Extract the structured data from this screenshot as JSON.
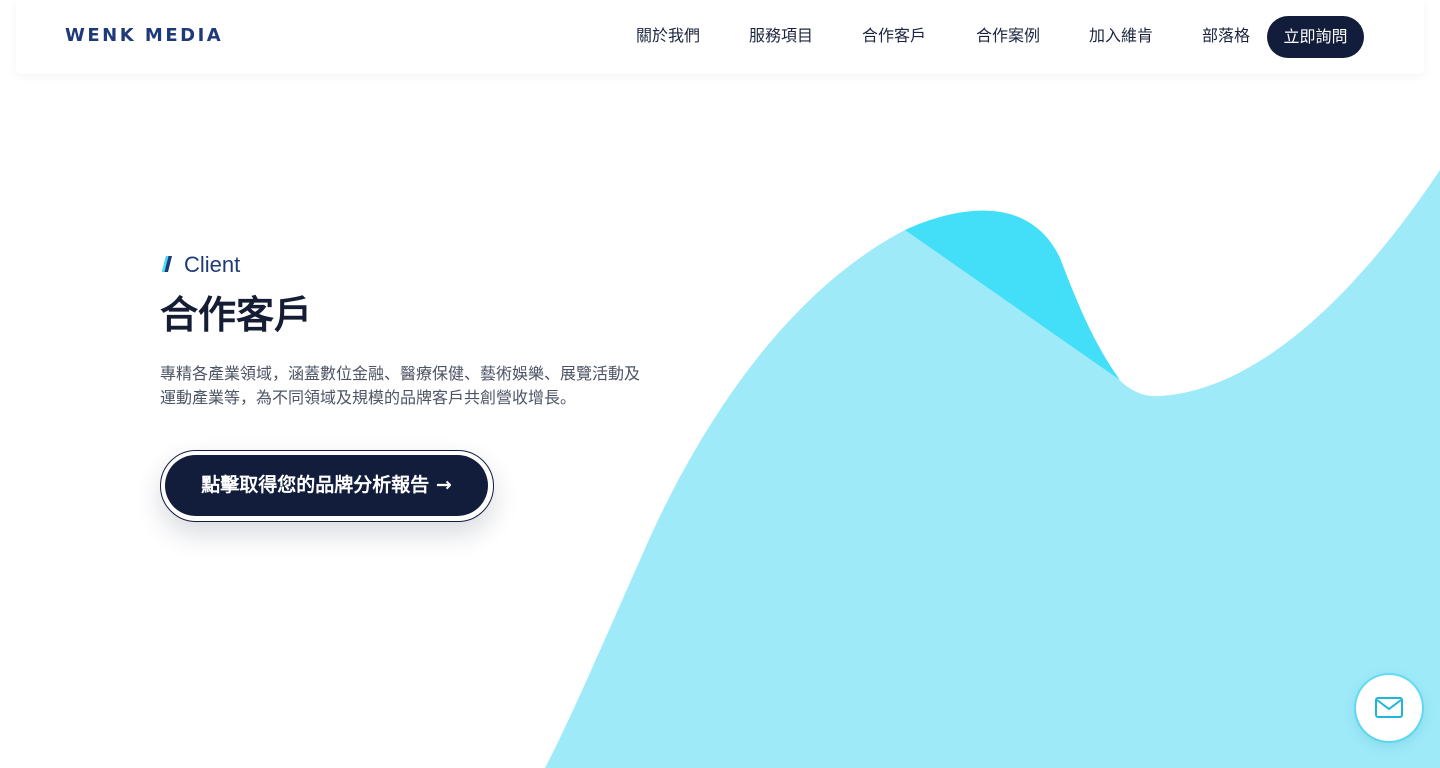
{
  "header": {
    "logo": "WENK MEDIA",
    "nav": [
      {
        "label": "關於我們"
      },
      {
        "label": "服務項目"
      },
      {
        "label": "合作客戶"
      },
      {
        "label": "合作案例"
      },
      {
        "label": "加入維肯"
      },
      {
        "label": "部落格"
      }
    ],
    "cta_label": "立即詢問"
  },
  "hero": {
    "eyebrow": "Client",
    "title": "合作客戶",
    "description": "專精各產業領域，涵蓋數位金融、醫療保健、藝術娛樂、展覽活動及運動產業等，為不同領域及規模的品牌客戶共創營收增長。",
    "report_button_label": "點擊取得您的品牌分析報告 →"
  },
  "floating": {
    "mail_icon": "mail-icon"
  },
  "colors": {
    "navy": "#121d3c",
    "brand_blue": "#1f3a7a",
    "wave_light": "#9eeaf9",
    "wave_bright": "#43dff8"
  }
}
